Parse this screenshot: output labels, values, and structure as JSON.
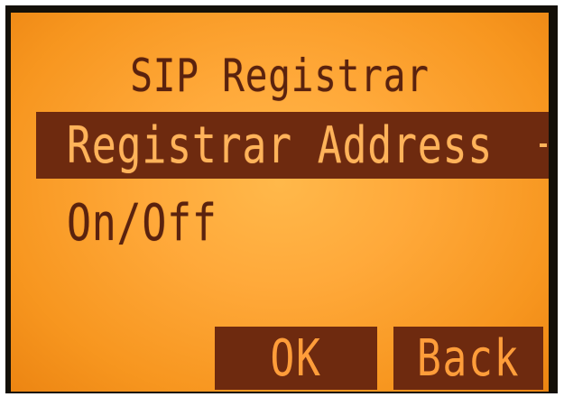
{
  "screen": {
    "title": "SIP Registrar",
    "menu": [
      {
        "label": "Registrar Address",
        "selected": true
      },
      {
        "label": "On/Off",
        "selected": false
      }
    ],
    "softkeys": {
      "ok_label": "OK",
      "back_label": "Back"
    }
  },
  "colors": {
    "lcd_background": "#ffa93a",
    "lcd_foreground": "#5a220e",
    "highlight": "#6e2a0f"
  }
}
